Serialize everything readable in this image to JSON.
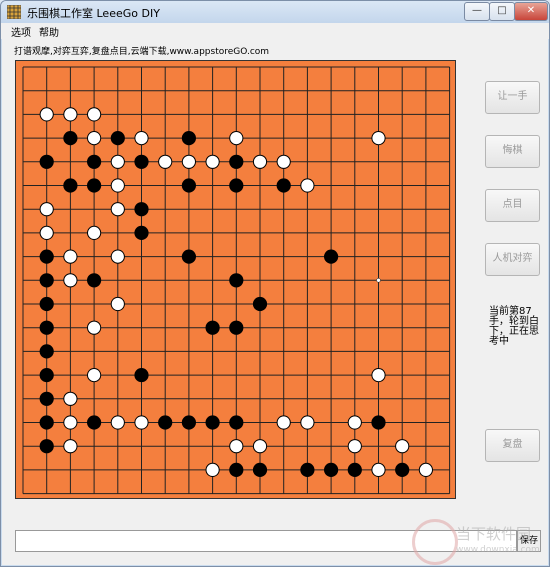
{
  "window": {
    "title": "乐围棋工作室 LeeeGo DIY",
    "minimize": "—",
    "maximize": "□",
    "close": "✕"
  },
  "menu": [
    "选项",
    "帮助"
  ],
  "info": "打谱观摩,对弈互弈,复盘点目,云端下载,www.appstoreGO.com",
  "buttons": [
    "让一手",
    "悔棋",
    "点目",
    "人机对弈",
    "复盘"
  ],
  "status": "当前第87手，轮到白下，正在思考中",
  "save_label": "保存",
  "watermark": {
    "name": "当下软件园",
    "url": "www.downxia.com"
  },
  "board": {
    "size": 19,
    "black": [
      [
        2,
        3
      ],
      [
        4,
        3
      ],
      [
        7,
        3
      ],
      [
        1,
        4
      ],
      [
        3,
        4
      ],
      [
        5,
        4
      ],
      [
        9,
        4
      ],
      [
        2,
        5
      ],
      [
        3,
        5
      ],
      [
        7,
        5
      ],
      [
        9,
        5
      ],
      [
        11,
        5
      ],
      [
        5,
        6
      ],
      [
        5,
        7
      ],
      [
        1,
        8
      ],
      [
        7,
        8
      ],
      [
        13,
        8
      ],
      [
        1,
        9
      ],
      [
        3,
        9
      ],
      [
        9,
        9
      ],
      [
        1,
        10
      ],
      [
        10,
        10
      ],
      [
        1,
        11
      ],
      [
        8,
        11
      ],
      [
        9,
        11
      ],
      [
        1,
        12
      ],
      [
        1,
        13
      ],
      [
        5,
        13
      ],
      [
        1,
        14
      ],
      [
        1,
        15
      ],
      [
        3,
        15
      ],
      [
        6,
        15
      ],
      [
        7,
        15
      ],
      [
        8,
        15
      ],
      [
        9,
        15
      ],
      [
        15,
        15
      ],
      [
        1,
        16
      ],
      [
        9,
        17
      ],
      [
        10,
        17
      ],
      [
        12,
        17
      ],
      [
        13,
        17
      ],
      [
        14,
        17
      ],
      [
        16,
        17
      ]
    ],
    "white": [
      [
        1,
        2
      ],
      [
        2,
        2
      ],
      [
        3,
        2
      ],
      [
        3,
        3
      ],
      [
        5,
        3
      ],
      [
        9,
        3
      ],
      [
        15,
        3
      ],
      [
        4,
        4
      ],
      [
        6,
        4
      ],
      [
        7,
        4
      ],
      [
        8,
        4
      ],
      [
        10,
        4
      ],
      [
        11,
        4
      ],
      [
        4,
        5
      ],
      [
        12,
        5
      ],
      [
        1,
        6
      ],
      [
        4,
        6
      ],
      [
        1,
        7
      ],
      [
        3,
        7
      ],
      [
        2,
        8
      ],
      [
        4,
        8
      ],
      [
        2,
        9
      ],
      [
        4,
        10
      ],
      [
        3,
        11
      ],
      [
        3,
        13
      ],
      [
        15,
        13
      ],
      [
        2,
        14
      ],
      [
        2,
        15
      ],
      [
        4,
        15
      ],
      [
        5,
        15
      ],
      [
        11,
        15
      ],
      [
        12,
        15
      ],
      [
        14,
        15
      ],
      [
        2,
        16
      ],
      [
        9,
        16
      ],
      [
        10,
        16
      ],
      [
        14,
        16
      ],
      [
        16,
        16
      ],
      [
        8,
        17
      ],
      [
        15,
        17
      ],
      [
        17,
        17
      ]
    ],
    "last_move": [
      14,
      15
    ],
    "hoshi": [
      [
        15,
        9
      ]
    ]
  }
}
